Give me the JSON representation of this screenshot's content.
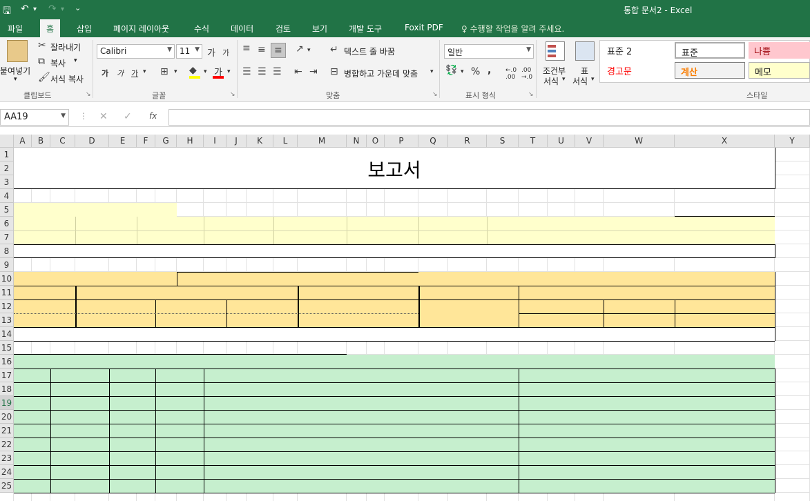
{
  "window": {
    "title": "통합 문서2 - Excel"
  },
  "quick_access": {
    "save": "🖫",
    "undo": "↶",
    "redo": "↷",
    "customize": "⌄"
  },
  "tabs": [
    "파일",
    "홈",
    "삽입",
    "페이지 레이아웃",
    "수식",
    "데이터",
    "검토",
    "보기",
    "개발 도구",
    "Foxit PDF"
  ],
  "active_tab": "홈",
  "tell_me": "수행할 작업을 알려 주세요.",
  "ribbon": {
    "clipboard": {
      "paste": "붙여넣기",
      "cut": "잘라내기",
      "copy": "복사",
      "format_painter": "서식 복사",
      "label": "클립보드"
    },
    "font": {
      "name": "Calibri",
      "size": "11",
      "grow": "가",
      "shrink": "가",
      "bold": "가",
      "italic": "가",
      "underline": "가",
      "color_letter": "가",
      "label": "글꼴"
    },
    "alignment": {
      "wrap": "텍스트 줄 바꿈",
      "merge": "병합하고 가운데 맞춤",
      "label": "맞춤"
    },
    "number": {
      "format": "일반",
      "percent": "%",
      "comma": ",",
      "label": "표시 형식"
    },
    "styles_buttons": {
      "conditional_1": "조건부",
      "conditional_2": "서식",
      "table_1": "표",
      "table_2": "서식",
      "label": "스타일"
    },
    "cell_styles": [
      {
        "name": "표준 2",
        "bg": "#ffffff",
        "color": "#000000"
      },
      {
        "name": "표준",
        "bg": "#ffffff",
        "color": "#000000"
      },
      {
        "name": "나쁨",
        "bg": "#ffc7ce",
        "color": "#9c0006"
      },
      {
        "name": "경고문",
        "bg": "#ffffff",
        "color": "#ff0000"
      },
      {
        "name": "계산",
        "bg": "#f2f2f2",
        "color": "#fa7d00"
      },
      {
        "name": "메모",
        "bg": "#ffffcc",
        "color": "#000000"
      }
    ]
  },
  "formula_bar": {
    "name_box": "AA19",
    "cancel": "✕",
    "enter": "✓",
    "fx": "fx",
    "value": ""
  },
  "columns": [
    "A",
    "B",
    "C",
    "D",
    "E",
    "F",
    "G",
    "H",
    "I",
    "J",
    "K",
    "L",
    "M",
    "N",
    "O",
    "P",
    "Q",
    "R",
    "S",
    "T",
    "U",
    "V",
    "W",
    "X",
    "Y"
  ],
  "rows": [
    "1",
    "2",
    "3",
    "4",
    "5",
    "6",
    "7",
    "8",
    "9",
    "10",
    "11",
    "12",
    "13",
    "14",
    "15",
    "16",
    "17",
    "18",
    "19",
    "20",
    "21",
    "22",
    "23",
    "24",
    "25"
  ],
  "selected_row": "19",
  "sheet": {
    "title": "보고서"
  },
  "colors": {
    "accent": "#217346",
    "light_yellow": "#ffffcc",
    "orange_fill": "#ffe699",
    "green_fill": "#c6efce"
  }
}
